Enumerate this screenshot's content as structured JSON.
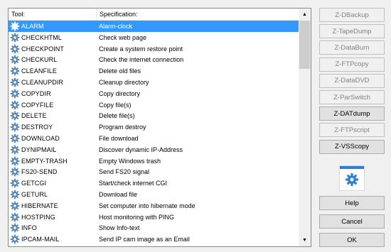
{
  "list": {
    "columns": {
      "tool": "Tool:",
      "spec": "Specification:"
    },
    "rows": [
      {
        "name": "ALARM",
        "spec": "Alarm-clock",
        "selected": true
      },
      {
        "name": "CHECKHTML",
        "spec": "Check web page"
      },
      {
        "name": "CHECKPOINT",
        "spec": "Create a system restore point"
      },
      {
        "name": "CHECKURL",
        "spec": "Check the internet connection"
      },
      {
        "name": "CLEANFILE",
        "spec": "Delete old files"
      },
      {
        "name": "CLEANUPDIR",
        "spec": "Cleanup directory"
      },
      {
        "name": "COPYDIR",
        "spec": "Copy directory"
      },
      {
        "name": "COPYFILE",
        "spec": "Copy file(s)"
      },
      {
        "name": "DELETE",
        "spec": "Delete file(s)"
      },
      {
        "name": "DESTROY",
        "spec": "Program destroy"
      },
      {
        "name": "DOWNLOAD",
        "spec": "File download"
      },
      {
        "name": "DYNIPMAIL",
        "spec": "Discover dynamic IP-Address"
      },
      {
        "name": "EMPTY-TRASH",
        "spec": "Empty Windows trash"
      },
      {
        "name": "FS20-SEND",
        "spec": "Send FS20 signal"
      },
      {
        "name": "GETCGI",
        "spec": "Start/check internet CGI"
      },
      {
        "name": "GETURL",
        "spec": "Download file"
      },
      {
        "name": "HIBERNATE",
        "spec": "Set computer into hibernate mode"
      },
      {
        "name": "HOSTPING",
        "spec": "Host monitoring with PING"
      },
      {
        "name": "INFO",
        "spec": "Show Info-text"
      },
      {
        "name": "IPCAM-MAIL",
        "spec": "Send IP cam image as an Email"
      }
    ]
  },
  "side_buttons": [
    {
      "label": "Z-DBackup",
      "enabled": false
    },
    {
      "label": "Z-TapeDump",
      "enabled": false
    },
    {
      "label": "Z-DataBurn",
      "enabled": false
    },
    {
      "label": "Z-FTPcopy",
      "enabled": false
    },
    {
      "label": "Z-DataDVD",
      "enabled": false
    },
    {
      "label": "Z-ParSwitch",
      "enabled": false
    },
    {
      "label": "Z-DATdump",
      "enabled": true
    },
    {
      "label": "Z-FTPscript",
      "enabled": false
    },
    {
      "label": "Z-VSScopy",
      "enabled": true
    }
  ],
  "bottom_buttons": {
    "help": "Help",
    "cancel": "Cancel",
    "ok": "OK"
  },
  "colors": {
    "selection": "#3399ff",
    "gear_icon": "#2b7fd6",
    "row_gear": "#5b8bb8"
  },
  "icons": {
    "row_icon": "gear-icon",
    "settings_tile": "gear-icon",
    "scroll_up": "triangle-up",
    "scroll_down": "triangle-down"
  }
}
